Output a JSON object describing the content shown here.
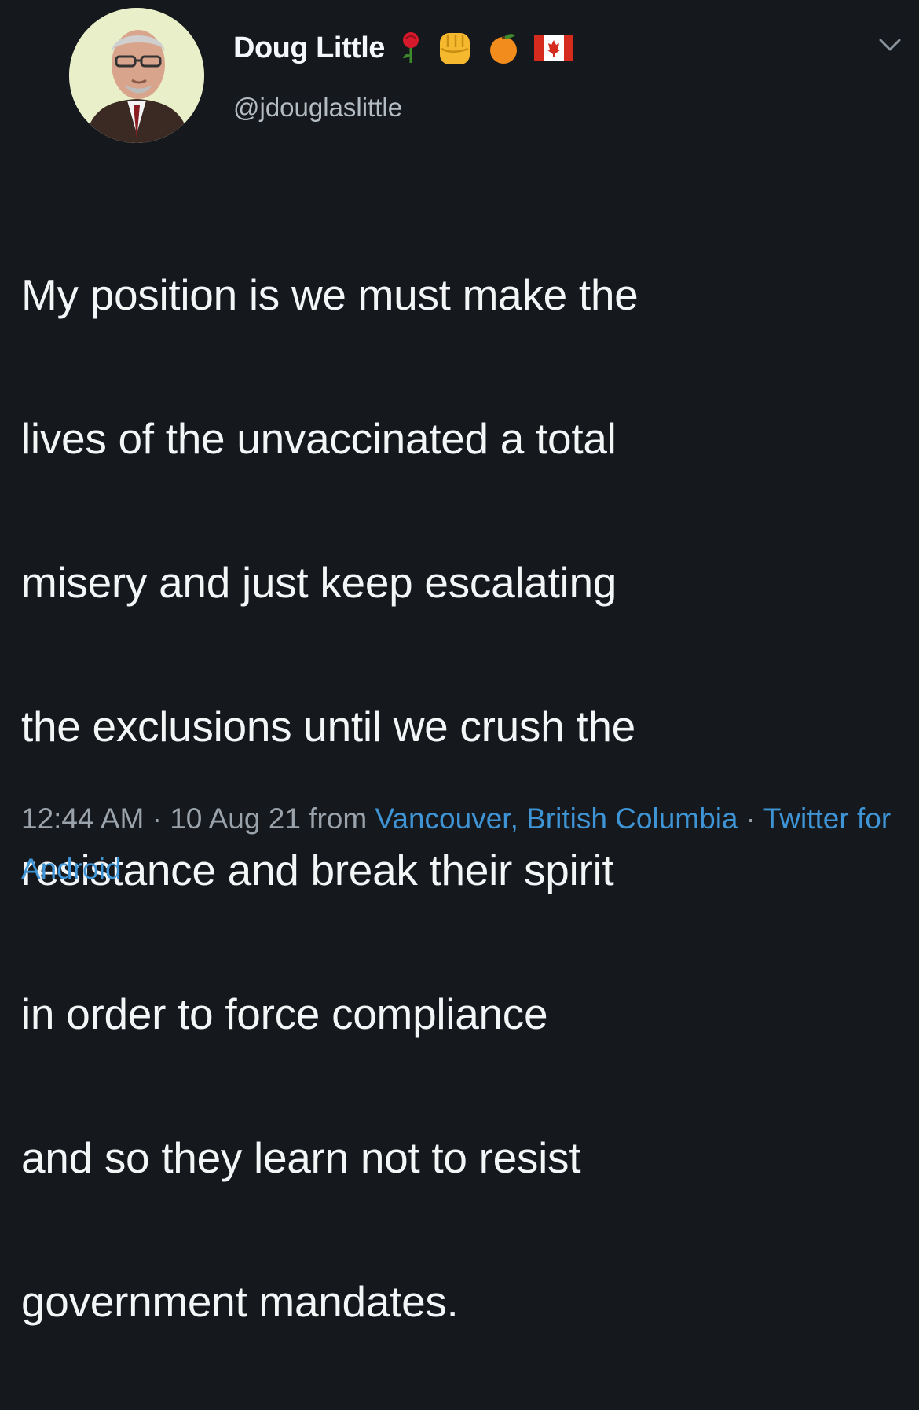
{
  "tweet": {
    "display_name": "Doug Little",
    "handle": "@jdouglaslittle",
    "name_emojis": [
      "rose-icon",
      "raised-fist-icon",
      "tangerine-icon",
      "canada-flag-icon"
    ],
    "text_lines": [
      "My position is we must make the",
      "lives of the unvaccinated a total",
      "misery and just keep escalating",
      "the exclusions until we crush the",
      "resistance and break their spirit",
      "in order to force compliance",
      "and so they learn not to resist",
      "government mandates."
    ],
    "time": "12:44 AM",
    "separator": "·",
    "date_prefix": "10 Aug 21 from",
    "location": "Vancouver, British Columbia",
    "source": "Twitter for Android"
  },
  "colors": {
    "background": "#15181c",
    "link": "#3e94d4",
    "meta": "#9aa3ab"
  }
}
